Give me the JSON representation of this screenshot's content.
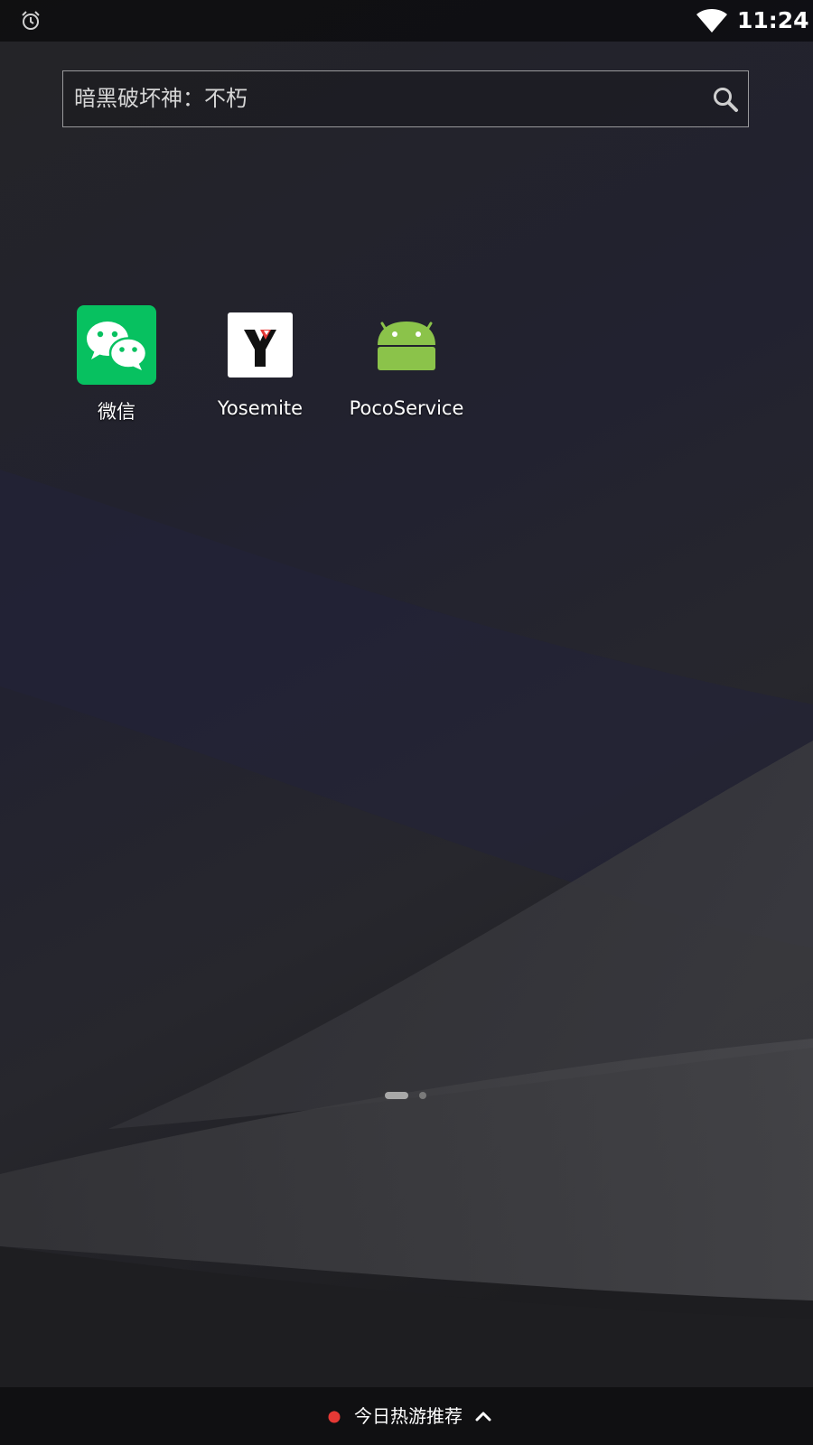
{
  "status_bar": {
    "time": "11:24",
    "icons": [
      "alarm-icon",
      "wifi-icon"
    ]
  },
  "search": {
    "query": "暗黑破坏神：不朽",
    "icon": "search-icon"
  },
  "apps": [
    {
      "label": "微信",
      "icon": "wechat-icon",
      "color": "#07C160"
    },
    {
      "label": "Yosemite",
      "icon": "yosemite-icon",
      "color": "#E53935"
    },
    {
      "label": "PocoService",
      "icon": "android-icon",
      "color": "#8BC34A"
    }
  ],
  "page_indicator": {
    "current_page": 1,
    "total_pages": 2
  },
  "bottom_bar": {
    "label": "今日热游推荐",
    "badge_color": "#E53935",
    "icon": "chevron-up-icon"
  }
}
